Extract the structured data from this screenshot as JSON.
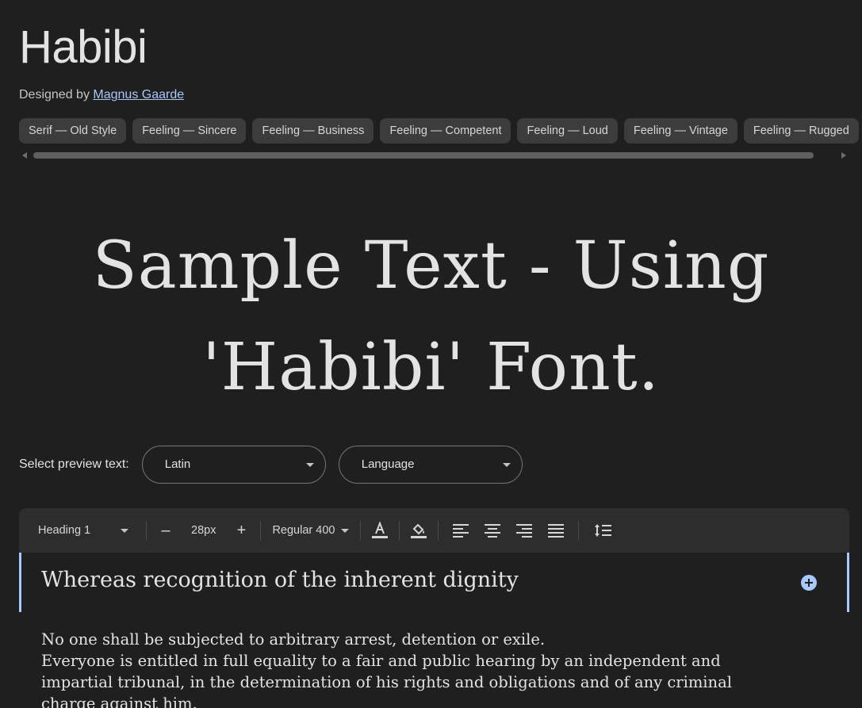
{
  "font": {
    "name": "Habibi",
    "designed_by_prefix": "Designed by ",
    "designer": "Magnus Gaarde"
  },
  "tags": [
    "Serif — Old Style",
    "Feeling — Sincere",
    "Feeling — Business",
    "Feeling — Competent",
    "Feeling — Loud",
    "Feeling — Vintage",
    "Feeling — Rugged"
  ],
  "sample": {
    "line1": "Sample Text - Using",
    "line2": "'Habibi' Font."
  },
  "preview": {
    "label": "Select preview text:",
    "script_value": "Latin",
    "language_value": "Language"
  },
  "toolbar": {
    "style": "Heading 1",
    "decrease": "–",
    "size": "28px",
    "increase": "+",
    "weight": "Regular 400",
    "icons": [
      "text-color-icon",
      "highlight-icon",
      "align-left-icon",
      "align-center-icon",
      "align-right-icon",
      "align-justify-icon",
      "line-spacing-icon"
    ]
  },
  "editor": {
    "heading": "Whereas recognition of the inherent dignity",
    "paragraph_line1": "No one shall be subjected to arbitrary arrest, detention or exile.",
    "paragraph_line2": "Everyone is entitled in full equality to a fair and public hearing by an independent and impartial tribunal, in the determination of his rights and obligations and of any criminal charge against him."
  },
  "colors": {
    "background": "#1f1f1f",
    "chip": "#3c3c3c",
    "accent": "#a8c7fa",
    "toolbar": "#2d2d2d"
  }
}
